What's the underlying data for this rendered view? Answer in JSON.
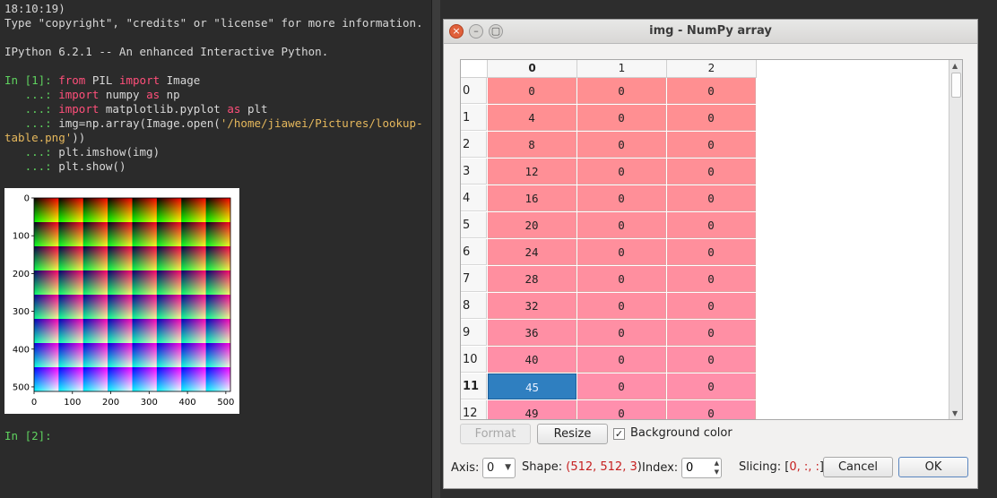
{
  "console": {
    "lines": [
      "18:10:19)",
      "Type \"copyright\", \"credits\" or \"license\" for more information.",
      "",
      "IPython 6.2.1 -- An enhanced Interactive Python.",
      ""
    ],
    "in1_prompt": "In [1]: ",
    "cont_prompt": "   ...: ",
    "kw_from": "from",
    "kw_import": "import",
    "kw_as": "as",
    "pil": " PIL ",
    "image_mod": " Image",
    "numpy": " numpy ",
    "np": " np",
    "mpl": " matplotlib.pyplot ",
    "plt": " plt",
    "img_code_a": "img=np.array(Image.open(",
    "img_code_str": "'/home/jiawei/Pictures/lookup-",
    "wrap_str": "table.png'",
    "wrap_rest": "))",
    "imshow": "plt.imshow(img)",
    "show": "plt.show()",
    "in2_prompt": "In [2]: "
  },
  "plot": {
    "y_ticks": [
      "0",
      "100",
      "200",
      "300",
      "400",
      "500"
    ],
    "x_ticks": [
      "0",
      "100",
      "200",
      "300",
      "400",
      "500"
    ]
  },
  "dialog": {
    "title": "img - NumPy array",
    "close_glyph": "×",
    "min_glyph": "–",
    "max_glyph": "▢",
    "columns": [
      "0",
      "1",
      "2"
    ],
    "rows": [
      {
        "idx": "0",
        "v": [
          "0",
          "0",
          "0"
        ],
        "color": "#ff8f91"
      },
      {
        "idx": "1",
        "v": [
          "4",
          "0",
          "0"
        ],
        "color": "#ff8f92"
      },
      {
        "idx": "2",
        "v": [
          "8",
          "0",
          "0"
        ],
        "color": "#ff8f94"
      },
      {
        "idx": "3",
        "v": [
          "12",
          "0",
          "0"
        ],
        "color": "#ff8f96"
      },
      {
        "idx": "4",
        "v": [
          "16",
          "0",
          "0"
        ],
        "color": "#ff8f98"
      },
      {
        "idx": "5",
        "v": [
          "20",
          "0",
          "0"
        ],
        "color": "#ff8f9a"
      },
      {
        "idx": "6",
        "v": [
          "24",
          "0",
          "0"
        ],
        "color": "#ff8f9c"
      },
      {
        "idx": "7",
        "v": [
          "28",
          "0",
          "0"
        ],
        "color": "#ff8f9f"
      },
      {
        "idx": "8",
        "v": [
          "32",
          "0",
          "0"
        ],
        "color": "#ff8fa1"
      },
      {
        "idx": "9",
        "v": [
          "36",
          "0",
          "0"
        ],
        "color": "#ff8fa4"
      },
      {
        "idx": "10",
        "v": [
          "40",
          "0",
          "0"
        ],
        "color": "#ff8fa7"
      },
      {
        "idx": "11",
        "v": [
          "45",
          "0",
          "0"
        ],
        "color": "#ff8faa"
      },
      {
        "idx": "12",
        "v": [
          "49",
          "0",
          "0"
        ],
        "color": "#ff8fad"
      }
    ],
    "selected": {
      "row": "11",
      "col": "0"
    },
    "format_label": "Format",
    "resize_label": "Resize",
    "bg_color_label": "Background color",
    "bg_color_checked": "✓",
    "axis_label": "Axis:",
    "axis_value": "0",
    "shape_label": "Shape: ",
    "shape_open": "(",
    "shape_value": "512, 512, 3",
    "shape_close": ")",
    "index_label": "Index:",
    "index_value": "0",
    "slicing_label": "Slicing: ",
    "slicing_open": "[",
    "slicing_value": "0, :, :",
    "slicing_close": "]",
    "cancel_label": "Cancel",
    "ok_label": "OK"
  }
}
